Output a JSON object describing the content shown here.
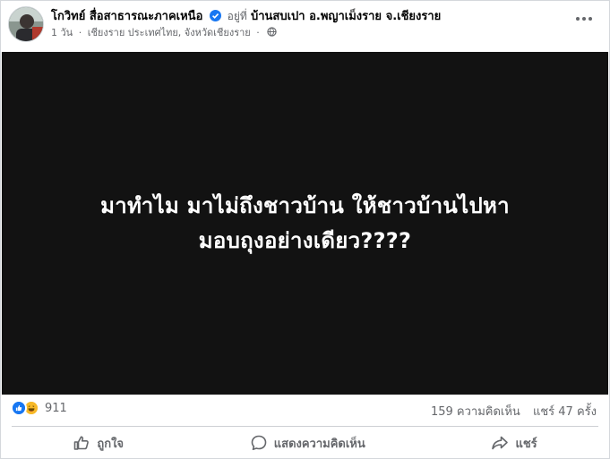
{
  "post": {
    "author": "โกวิทย์ สื่อสาธารณะภาคเหนือ",
    "at_label": "อยู่ที่",
    "location": "บ้านสบเปา อ.พญาเม็งราย จ.เชียงราย",
    "time": "1 วัน",
    "separator": "·",
    "place_detail": "เชียงราย ประเทศไทย, จังหวัดเชียงราย",
    "separator2": "·",
    "media_text_line1": "มาทำไม มาไม่ถึงชาวบ้าน ให้ชาวบ้านไปหา",
    "media_text_line2": "มอบถุงอย่างเดียว????"
  },
  "stats": {
    "reaction_count": "911",
    "comments": "159 ความคิดเห็น",
    "shares": "แชร์ 47 ครั้ง",
    "reactions": [
      "like-icon",
      "haha-icon"
    ]
  },
  "actions": {
    "like_label": "ถูกใจ",
    "comment_label": "แสดงความคิดเห็น",
    "share_label": "แชร์"
  },
  "colors": {
    "accent": "#1877f2",
    "muted_text": "#65676b",
    "media_bg": "#121212",
    "haha": "#f7b928"
  }
}
